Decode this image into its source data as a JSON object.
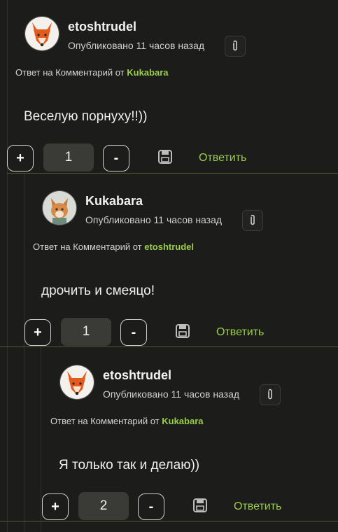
{
  "colors": {
    "background": "#1c1c1a",
    "accent": "#9acd4a",
    "separator": "#4c5a2c"
  },
  "comments": [
    {
      "username": "etoshtrudel",
      "avatar": "fox-avatar",
      "published": "Опубликовано 11 часов назад",
      "reply_prefix": "Ответ на Комментарий от",
      "reply_author": "Kukabara",
      "text": "Веселую порнуху!!))",
      "vote_count": "1",
      "plus_label": "+",
      "minus_label": "-",
      "reply_label": "Ответить"
    },
    {
      "username": "Kukabara",
      "avatar": "cartoon-avatar",
      "published": "Опубликовано 11 часов назад",
      "reply_prefix": "Ответ на Комментарий от",
      "reply_author": "etoshtrudel",
      "text": "дрочить и смеяцо!",
      "vote_count": "1",
      "plus_label": "+",
      "minus_label": "-",
      "reply_label": "Ответить"
    },
    {
      "username": "etoshtrudel",
      "avatar": "fox-avatar",
      "published": "Опубликовано 11 часов назад",
      "reply_prefix": "Ответ на Комментарий от",
      "reply_author": "Kukabara",
      "text": "Я только так и делаю))",
      "vote_count": "2",
      "plus_label": "+",
      "minus_label": "-",
      "reply_label": "Ответить"
    }
  ]
}
